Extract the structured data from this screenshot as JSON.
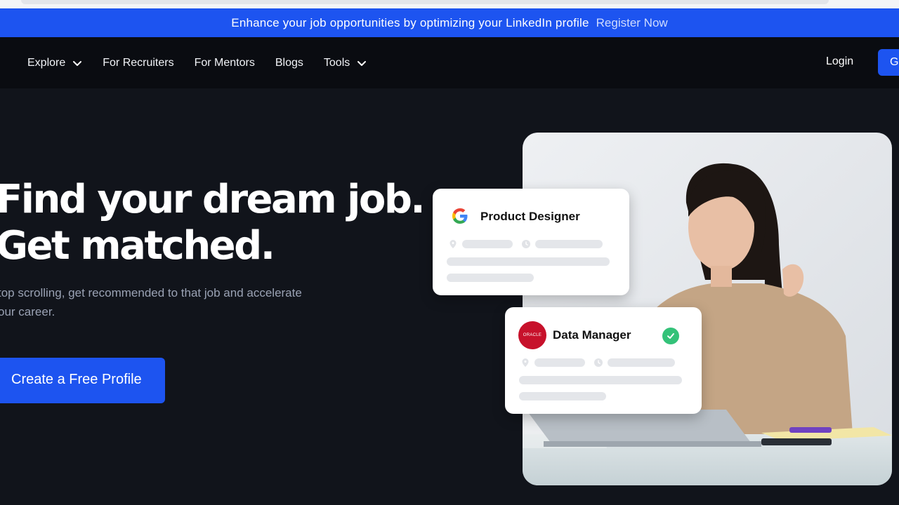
{
  "banner": {
    "message": "Enhance your job opportunities by optimizing your LinkedIn profile",
    "cta": "Register Now"
  },
  "nav": {
    "items": [
      {
        "label": "Explore",
        "dropdown": true
      },
      {
        "label": "For Recruiters",
        "dropdown": false
      },
      {
        "label": "For Mentors",
        "dropdown": false
      },
      {
        "label": "Blogs",
        "dropdown": false
      },
      {
        "label": "Tools",
        "dropdown": true
      }
    ],
    "login": "Login",
    "get_started": "G"
  },
  "hero": {
    "title_line1": "Find your dream job.",
    "title_line2": "Get matched.",
    "subtitle_line1": "top scrolling, get recommended to that job and accelerate",
    "subtitle_line2": "our career.",
    "cta": "Create a Free Profile"
  },
  "cards": [
    {
      "company_icon": "google-logo-icon",
      "title": "Product Designer"
    },
    {
      "company_icon": "oracle-logo-icon",
      "company_text": "ORACLE",
      "title": "Data Manager",
      "verified": true
    }
  ],
  "colors": {
    "accent": "#1d54f0",
    "background": "#11141b",
    "nav_background": "#0a0c11",
    "success": "#34c279",
    "oracle_red": "#c7112b"
  }
}
